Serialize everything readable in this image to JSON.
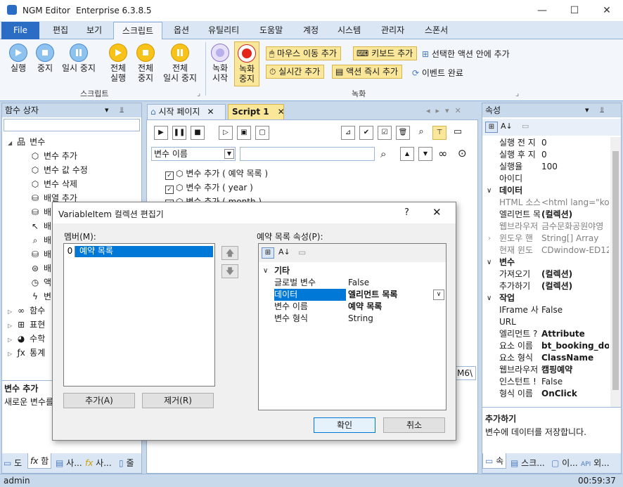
{
  "window": {
    "app_name": "NGM Editor",
    "edition": "Enterprise 6.3.8.5",
    "minimize": "—",
    "maximize": "☐",
    "close": "✕"
  },
  "menu": {
    "file": "File",
    "items": [
      "편집",
      "보기",
      "스크립트",
      "옵션",
      "유틸리티",
      "도움말",
      "계정",
      "시스템",
      "관리자",
      "스폰서"
    ]
  },
  "ribbon": {
    "run": "실행",
    "stop": "중지",
    "pause": "일시 중지",
    "all_run": [
      "전체",
      "실행"
    ],
    "all_stop": [
      "전체",
      "중지"
    ],
    "all_pause": [
      "전체",
      "일시 중지"
    ],
    "group_script": "스크립트",
    "rec_start": [
      "녹화",
      "시작"
    ],
    "rec_stop": [
      "녹화",
      "중지"
    ],
    "mouse_add": "마우스 이동 추가",
    "key_add": "키보드 추가",
    "delay_add": "실시간 추가",
    "action_add": "액션 즉시 추가",
    "in_selected": "선택한 액션 안에 추가",
    "event_done": "이벤트 완료",
    "group_record": "녹화"
  },
  "left_panel": {
    "title": "함수 상자",
    "tree": [
      {
        "label": "변수",
        "icon": "tree-icon"
      },
      {
        "label": "변수 추가",
        "icon": "cube-icon"
      },
      {
        "label": "변수 값 수정",
        "icon": "cube-icon"
      },
      {
        "label": "변수 삭제",
        "icon": "cube-icon"
      },
      {
        "label": "배열 추가",
        "icon": "database-icon"
      },
      {
        "label": "배",
        "icon": "database-icon"
      },
      {
        "label": "배",
        "icon": "pointer-icon"
      },
      {
        "label": "배",
        "icon": "search-icon"
      },
      {
        "label": "배",
        "icon": "database-icon"
      },
      {
        "label": "배",
        "icon": "toggle-icon"
      },
      {
        "label": "액",
        "icon": "clock-icon"
      },
      {
        "label": "변",
        "icon": "bolt-icon"
      },
      {
        "label": "함수",
        "icon": "infinity-icon"
      },
      {
        "label": "표현",
        "icon": "grid-icon"
      },
      {
        "label": "수학",
        "icon": "pie-icon"
      },
      {
        "label": "통계",
        "icon": "fx-icon"
      }
    ],
    "desc_title": "변수 추가",
    "desc_text": "새로운 변수를",
    "bottom_tabs": [
      "도",
      "함",
      "사...",
      "사...",
      "줄"
    ]
  },
  "editor": {
    "tabs": [
      "시작 페이지",
      "Script 1"
    ],
    "combo_value": "변수 이름",
    "search_value": "",
    "lines": [
      "변수 추가 ( 예약 목록 )",
      "변수 추가 ( year )",
      "변수 추가 ( month )"
    ],
    "partial_text": "M6\\"
  },
  "dialog": {
    "title": "VariableItem 컬렉션 편집기",
    "help": "?",
    "members_label": "멤버(M):",
    "member_index": "0",
    "member_name": "예약 목록",
    "props_label": "예약 목록 속성(P):",
    "category": "기타",
    "rows": [
      {
        "key": "글로벌 변수",
        "value": "False",
        "bold": false
      },
      {
        "key": "데이터",
        "value": "엘리먼트 목록",
        "bold": true
      },
      {
        "key": "변수 이름",
        "value": "예약 목록",
        "bold": true
      },
      {
        "key": "변수 형식",
        "value": "String",
        "bold": false
      }
    ],
    "add": "추가(A)",
    "remove": "제거(R)",
    "ok": "확인",
    "cancel": "취소"
  },
  "right_panel": {
    "title": "속성",
    "rows": [
      {
        "key": "실행 전 지",
        "value": "0",
        "type": "row"
      },
      {
        "key": "실행 후 지",
        "value": "0",
        "type": "row"
      },
      {
        "key": "실행율",
        "value": "100",
        "type": "row"
      },
      {
        "key": "아이디",
        "value": "",
        "type": "row"
      },
      {
        "key": "데이터",
        "value": "",
        "type": "cat"
      },
      {
        "key": "HTML 소스",
        "value": "<html lang=\"ko\">",
        "type": "gray"
      },
      {
        "key": "엘리먼트 목",
        "value": "(컬렉션)",
        "type": "bold"
      },
      {
        "key": "웹브라우저",
        "value": "금수문화공원야영",
        "type": "gray"
      },
      {
        "key": "윈도우 핸",
        "value": "String[] Array",
        "type": "gray"
      },
      {
        "key": "현재 윈도",
        "value": "CDwindow-ED12",
        "type": "gray"
      },
      {
        "key": "변수",
        "value": "",
        "type": "cat"
      },
      {
        "key": "가져오기",
        "value": "(컬렉션)",
        "type": "bold"
      },
      {
        "key": "추가하기",
        "value": "(컬렉션)",
        "type": "bold"
      },
      {
        "key": "작업",
        "value": "",
        "type": "cat"
      },
      {
        "key": "IFrame 사",
        "value": "False",
        "type": "row"
      },
      {
        "key": "URL",
        "value": "",
        "type": "row"
      },
      {
        "key": "엘리먼트 ?",
        "value": "Attribute",
        "type": "bold"
      },
      {
        "key": "요소 이름",
        "value": "bt_booking_doi",
        "type": "bold"
      },
      {
        "key": "요소 형식",
        "value": "ClassName",
        "type": "bold"
      },
      {
        "key": "웹브라우저",
        "value": "캠핑예약",
        "type": "bold"
      },
      {
        "key": "인스턴트 !",
        "value": "False",
        "type": "row"
      },
      {
        "key": "형식 이름",
        "value": "OnClick",
        "type": "bold"
      }
    ],
    "desc_title": "추가하기",
    "desc_text": "변수에 데이터를 저장합니다.",
    "bottom_tabs": [
      "속",
      "스크...",
      "이...",
      "외..."
    ]
  },
  "status": {
    "user": "admin",
    "time": "00:59:37"
  }
}
